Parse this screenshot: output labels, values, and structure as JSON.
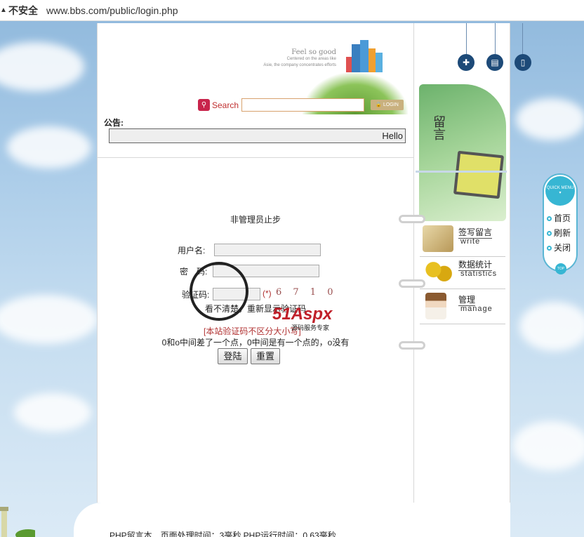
{
  "browser": {
    "insecure_label": "不安全",
    "url": "www.bbs.com/public/login.php"
  },
  "header": {
    "slogan_big": "Feel so good",
    "slogan_line1": "Centered on the areas like",
    "slogan_line2": "Asie, the company concentrates efforts",
    "search_label": "Search",
    "search_placeholder": "",
    "login_label": "LOGIN",
    "notice_label": "公告:",
    "notice_text": "Hello"
  },
  "form": {
    "title": "非管理员止步",
    "username_label": "用户名:",
    "password_label": "密　码:",
    "captcha_label": "验证码:",
    "required_mark": "(*)",
    "captcha_text": "6 7 1 0",
    "refresh_hint": "看不清楚，重新显示验证码",
    "case_hint": "[本站验证码不区分大小写]",
    "char_hint": "0和o中间差了一个点，0中间是有一个点的，o没有",
    "login_button": "登陆",
    "reset_button": "重置"
  },
  "watermark": {
    "brand": "51Aspx",
    "subtitle": "源码服务专家"
  },
  "sidebar": {
    "guestbook_word": "留言",
    "items": [
      {
        "cn": "签写留言",
        "en": "write"
      },
      {
        "cn": "数据统计",
        "en": "statistics"
      },
      {
        "cn": "管理",
        "en": "manage"
      }
    ]
  },
  "quick_menu": {
    "head": "QUICK MENU",
    "items": [
      "首页",
      "刷新",
      "关闭"
    ],
    "top": "TOP"
  },
  "footer": {
    "text": "PHP留言本　页面处理时间：3毫秒 PHP运行时间：0.63毫秒"
  }
}
